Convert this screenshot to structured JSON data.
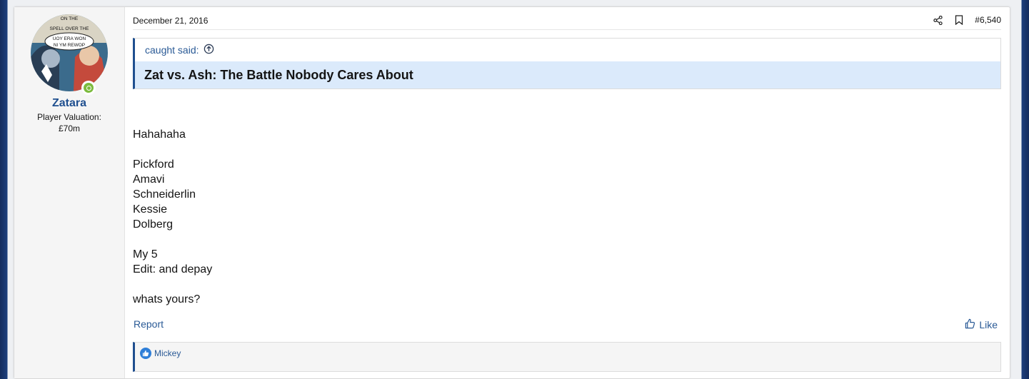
{
  "post": {
    "date": "December 21, 2016",
    "number": "#6,540",
    "icons": {
      "share": "share-icon",
      "bookmark": "bookmark-icon",
      "online": "online-status-icon"
    }
  },
  "user": {
    "name": "Zatara",
    "valuation_label": "Player Valuation:",
    "valuation_value": "£70m",
    "avatar_text": [
      "ON THE",
      "SPELL OVER THE",
      "UOY ERA WON",
      "NI YM REWOP"
    ]
  },
  "quote": {
    "author": "caught said:",
    "text": "Zat vs. Ash: The Battle Nobody Cares About"
  },
  "body": {
    "lines": [
      "Hahahaha",
      "",
      "Pickford",
      "Amavi",
      "Schneiderlin",
      "Kessie",
      "Dolberg",
      "",
      "My 5",
      "Edit: and depay",
      "",
      "whats yours?"
    ]
  },
  "footer": {
    "report": "Report",
    "like": "Like"
  },
  "reactions": {
    "users": "Mickey"
  },
  "colors": {
    "link": "#2a5a96",
    "accent": "#1f4f8f",
    "quote_bg": "#dbeafb",
    "online": "#7cbb3d"
  }
}
